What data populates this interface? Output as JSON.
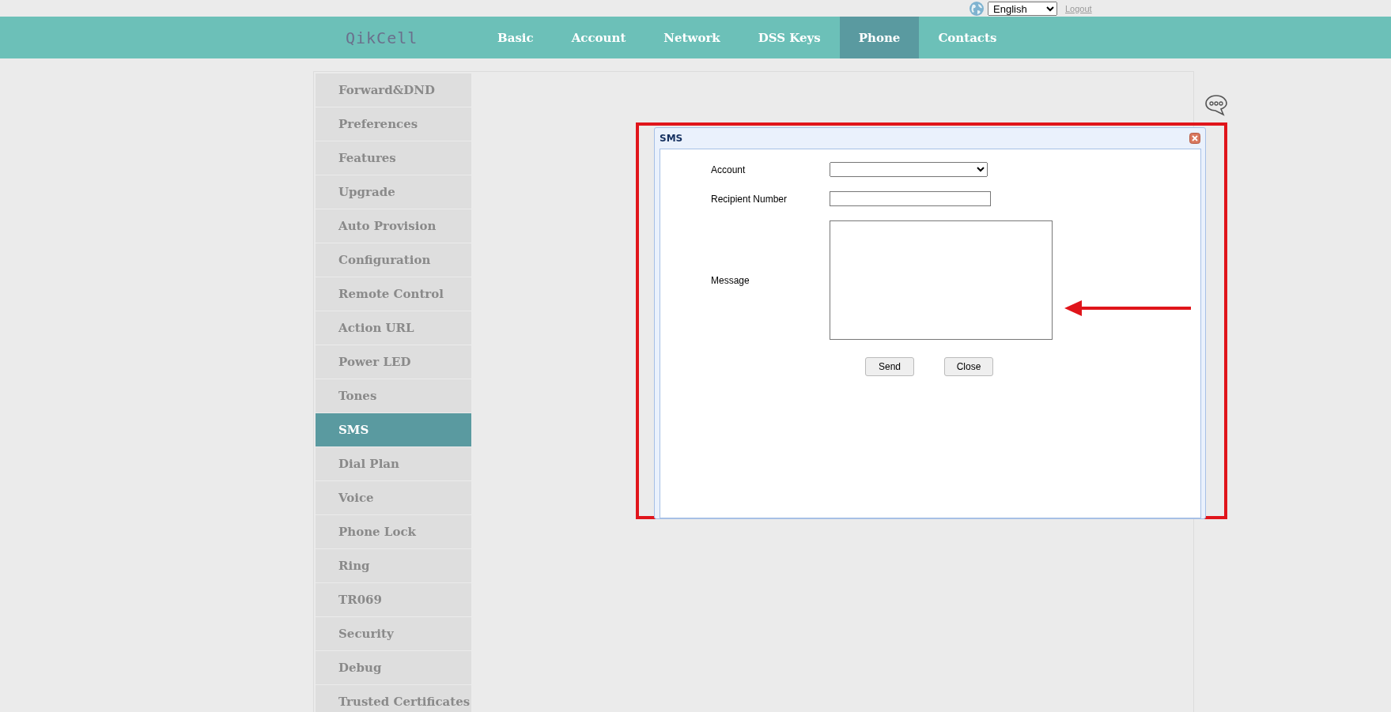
{
  "top_bar": {
    "language": "English",
    "logout": "Logout"
  },
  "header": {
    "logo": "QikCell",
    "tabs": [
      {
        "label": "Basic",
        "selected": false
      },
      {
        "label": "Account",
        "selected": false
      },
      {
        "label": "Network",
        "selected": false
      },
      {
        "label": "DSS Keys",
        "selected": false
      },
      {
        "label": "Phone",
        "selected": true
      },
      {
        "label": "Contacts",
        "selected": false
      }
    ]
  },
  "sidebar": {
    "items": [
      {
        "label": "Forward&DND",
        "selected": false
      },
      {
        "label": "Preferences",
        "selected": false
      },
      {
        "label": "Features",
        "selected": false
      },
      {
        "label": "Upgrade",
        "selected": false
      },
      {
        "label": "Auto Provision",
        "selected": false
      },
      {
        "label": "Configuration",
        "selected": false
      },
      {
        "label": "Remote Control",
        "selected": false
      },
      {
        "label": "Action URL",
        "selected": false
      },
      {
        "label": "Power LED",
        "selected": false
      },
      {
        "label": "Tones",
        "selected": false
      },
      {
        "label": "SMS",
        "selected": true
      },
      {
        "label": "Dial Plan",
        "selected": false
      },
      {
        "label": "Voice",
        "selected": false
      },
      {
        "label": "Phone Lock",
        "selected": false
      },
      {
        "label": "Ring",
        "selected": false
      },
      {
        "label": "TR069",
        "selected": false
      },
      {
        "label": "Security",
        "selected": false
      },
      {
        "label": "Debug",
        "selected": false
      },
      {
        "label": "Trusted Certificates",
        "selected": false
      }
    ]
  },
  "dialog": {
    "title": "SMS",
    "fields": [
      {
        "kind": "select",
        "label": "Account"
      },
      {
        "kind": "text",
        "label": "Recipient Number"
      },
      {
        "kind": "textarea",
        "label": "Message"
      }
    ],
    "buttons": [
      "Send",
      "Close"
    ]
  }
}
